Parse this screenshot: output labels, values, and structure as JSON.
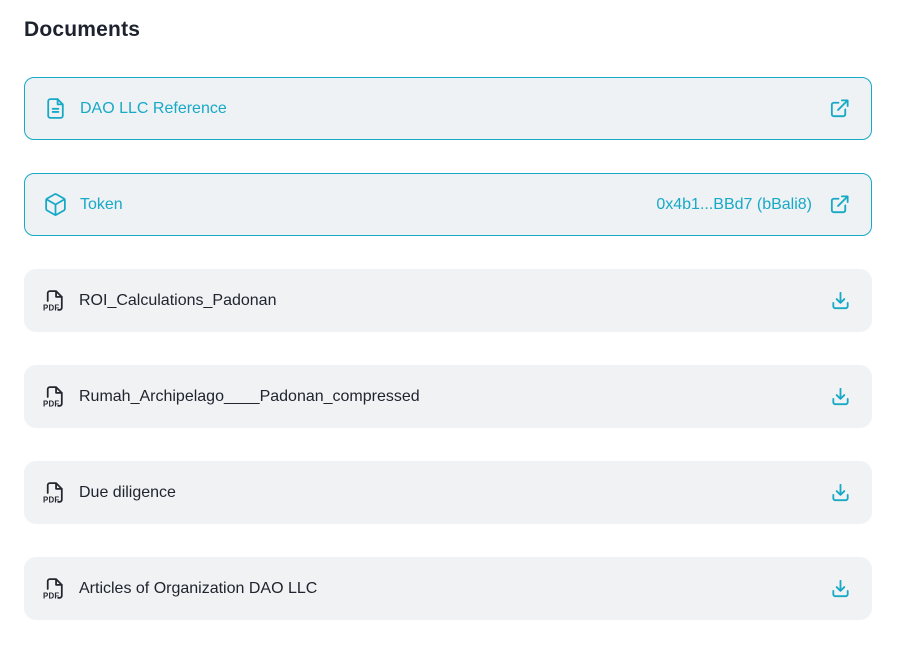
{
  "page": {
    "title": "Documents"
  },
  "colors": {
    "accent": "#17A9C6",
    "link_card_bg": "#EEF2F5",
    "file_card_bg": "#F1F2F4",
    "text": "#20242E",
    "title": "#1D222E"
  },
  "documents": [
    {
      "type": "link",
      "icon": "document-icon",
      "label": "DAO LLC Reference",
      "value": "",
      "action_icon": "external-link-icon"
    },
    {
      "type": "link",
      "icon": "cube-icon",
      "label": "Token",
      "value": "0x4b1...BBd7 (bBali8)",
      "action_icon": "external-link-icon"
    },
    {
      "type": "pdf",
      "icon": "pdf-icon",
      "label": "ROI_Calculations_Padonan",
      "value": "",
      "action_icon": "download-icon"
    },
    {
      "type": "pdf",
      "icon": "pdf-icon",
      "label": "Rumah_Archipelago____Padonan_compressed",
      "value": "",
      "action_icon": "download-icon"
    },
    {
      "type": "pdf",
      "icon": "pdf-icon",
      "label": "Due diligence",
      "value": "",
      "action_icon": "download-icon"
    },
    {
      "type": "pdf",
      "icon": "pdf-icon",
      "label": "Articles of Organization DAO LLC",
      "value": "",
      "action_icon": "download-icon"
    }
  ]
}
